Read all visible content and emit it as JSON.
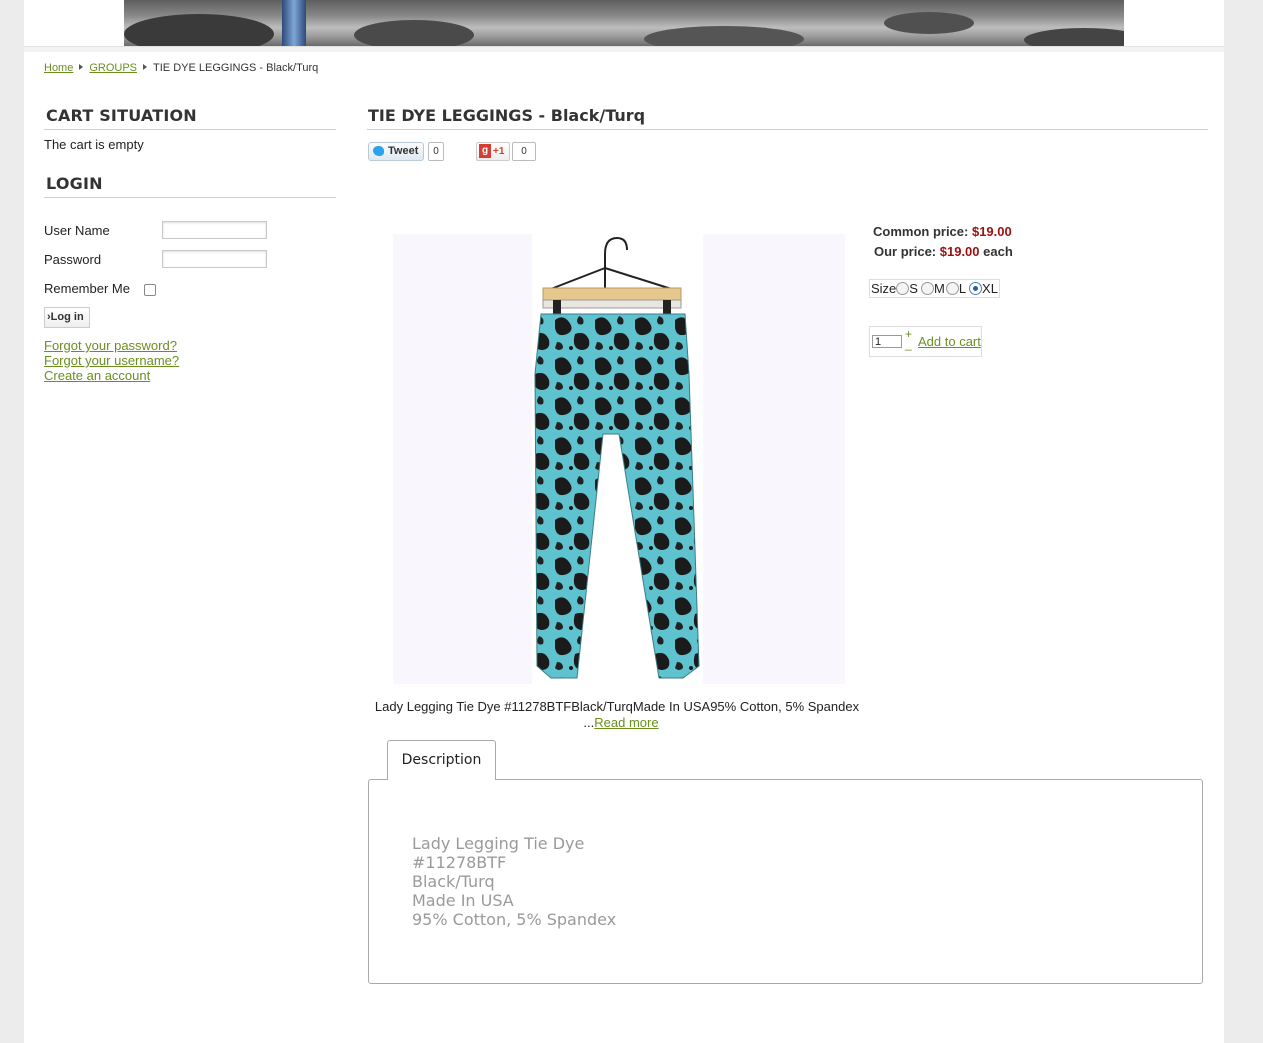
{
  "breadcrumb": {
    "home": "Home",
    "groups": "GROUPS",
    "current": "TIE DYE LEGGINGS - Black/Turq"
  },
  "sidebar": {
    "cart_heading": "CART SITUATION",
    "cart_status": "The cart is empty",
    "login_heading": "LOGIN",
    "username_label": "User Name",
    "password_label": "Password",
    "remember_label": "Remember Me",
    "login_button": "Log in",
    "links": [
      "Forgot your password?",
      "Forgot your username?",
      "Create an account"
    ]
  },
  "product": {
    "title": "TIE DYE LEGGINGS - Black/Turq",
    "social": {
      "tweet_label": "Tweet",
      "tweet_count": "0",
      "gplus_label": "+1",
      "gplus_count": "0"
    },
    "common_price_label": "Common price:",
    "common_price": "$19.00",
    "our_price_label": "Our price:",
    "our_price": "$19.00",
    "our_price_suffix": "each",
    "size_label": "Size",
    "sizes": [
      "S",
      "M",
      "L",
      "XL"
    ],
    "selected_size": "XL",
    "quantity": "1",
    "qty_plus": "+",
    "qty_minus": "_",
    "add_to_cart": "Add to cart",
    "short_description": "Lady Legging Tie Dye #11278BTFBlack/TurqMade In USA95% Cotton, 5% Spandex",
    "ellipsis": "...",
    "read_more": "Read more",
    "tab_label": "Description",
    "description_lines": [
      "Lady Legging Tie Dye",
      "#11278BTF",
      "Black/Turq",
      "Made In USA",
      "95% Cotton, 5% Spandex"
    ]
  },
  "colors": {
    "link": "#6a8f1f",
    "price": "#9b1010",
    "legging_turquoise": "#5fc3cf",
    "legging_black": "#1b1b1b"
  }
}
